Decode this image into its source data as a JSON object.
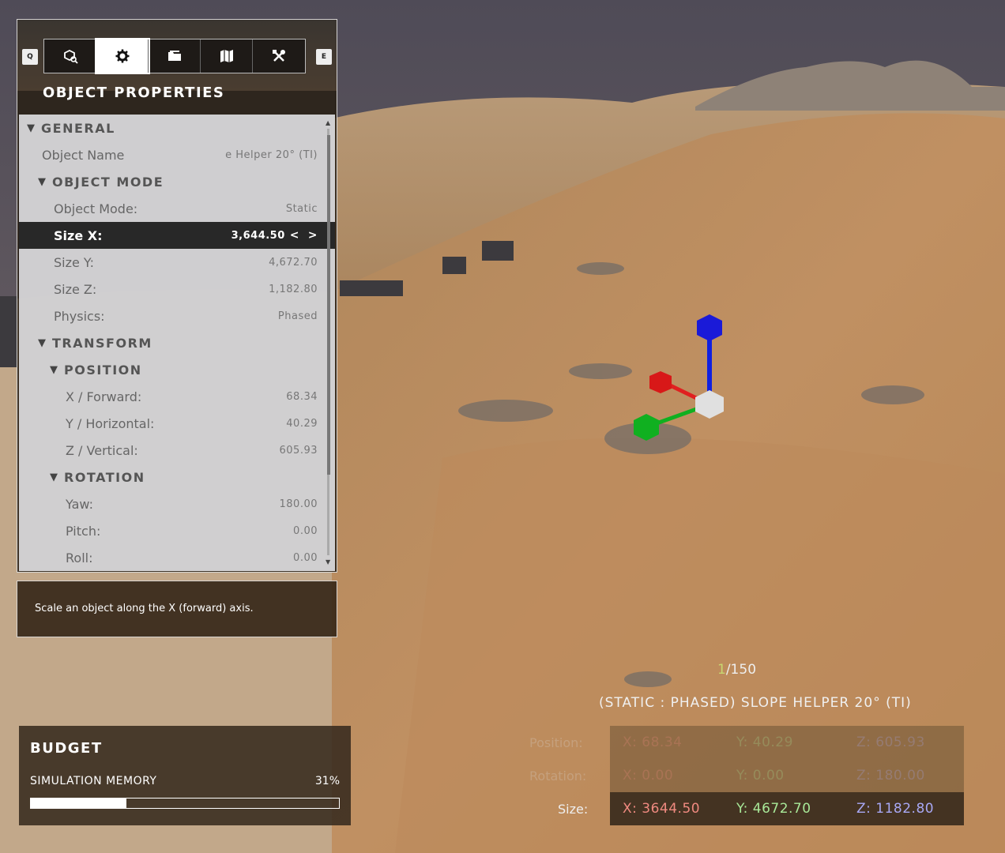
{
  "toolbar": {
    "left_key": "Q",
    "right_key": "E",
    "tabs": [
      {
        "icon": "object-browser-icon",
        "active": false
      },
      {
        "icon": "gear-icon",
        "active": true
      },
      {
        "icon": "folder-icon",
        "active": false
      },
      {
        "icon": "map-icon",
        "active": false
      },
      {
        "icon": "tools-icon",
        "active": false
      }
    ]
  },
  "panel": {
    "title": "OBJECT PROPERTIES",
    "general": {
      "header": "GENERAL",
      "object_name_label": "Object Name",
      "object_name_value": "e Helper 20° (TI)"
    },
    "object_mode": {
      "header": "OBJECT MODE",
      "mode_label": "Object Mode:",
      "mode_value": "Static",
      "size_x_label": "Size X:",
      "size_x_value": "3,644.50",
      "size_y_label": "Size Y:",
      "size_y_value": "4,672.70",
      "size_z_label": "Size Z:",
      "size_z_value": "1,182.80",
      "physics_label": "Physics:",
      "physics_value": "Phased"
    },
    "transform": {
      "header": "TRANSFORM",
      "position": {
        "header": "POSITION",
        "x_label": "X / Forward:",
        "x_value": "68.34",
        "y_label": "Y / Horizontal:",
        "y_value": "40.29",
        "z_label": "Z / Vertical:",
        "z_value": "605.93"
      },
      "rotation": {
        "header": "ROTATION",
        "yaw_label": "Yaw:",
        "yaw_value": "180.00",
        "pitch_label": "Pitch:",
        "pitch_value": "0.00",
        "roll_label": "Roll:",
        "roll_value": "0.00"
      }
    }
  },
  "tooltip": "Scale an object along the X (forward) axis.",
  "budget": {
    "title": "BUDGET",
    "memory_label": "SIMULATION MEMORY",
    "memory_percent_text": "31%",
    "memory_fraction": 0.31
  },
  "hud": {
    "counter_current": "1",
    "counter_total": "/150",
    "object_name": "(STATIC : PHASED) SLOPE HELPER 20° (TI)",
    "position_label": "Position:",
    "position": {
      "x": "X: 68.34",
      "y": "Y: 40.29",
      "z": "Z: 605.93"
    },
    "rotation_label": "Rotation:",
    "rotation": {
      "x": "X: 0.00",
      "y": "Y: 0.00",
      "z": "Z: 180.00"
    },
    "size_label": "Size:",
    "size": {
      "x": "X: 3644.50",
      "y": "Y: 4672.70",
      "z": "Z: 1182.80"
    }
  },
  "colors": {
    "gizmo_x": "#e02020",
    "gizmo_y": "#10b020",
    "gizmo_z": "#1020e0",
    "sand": "#b8895a"
  }
}
